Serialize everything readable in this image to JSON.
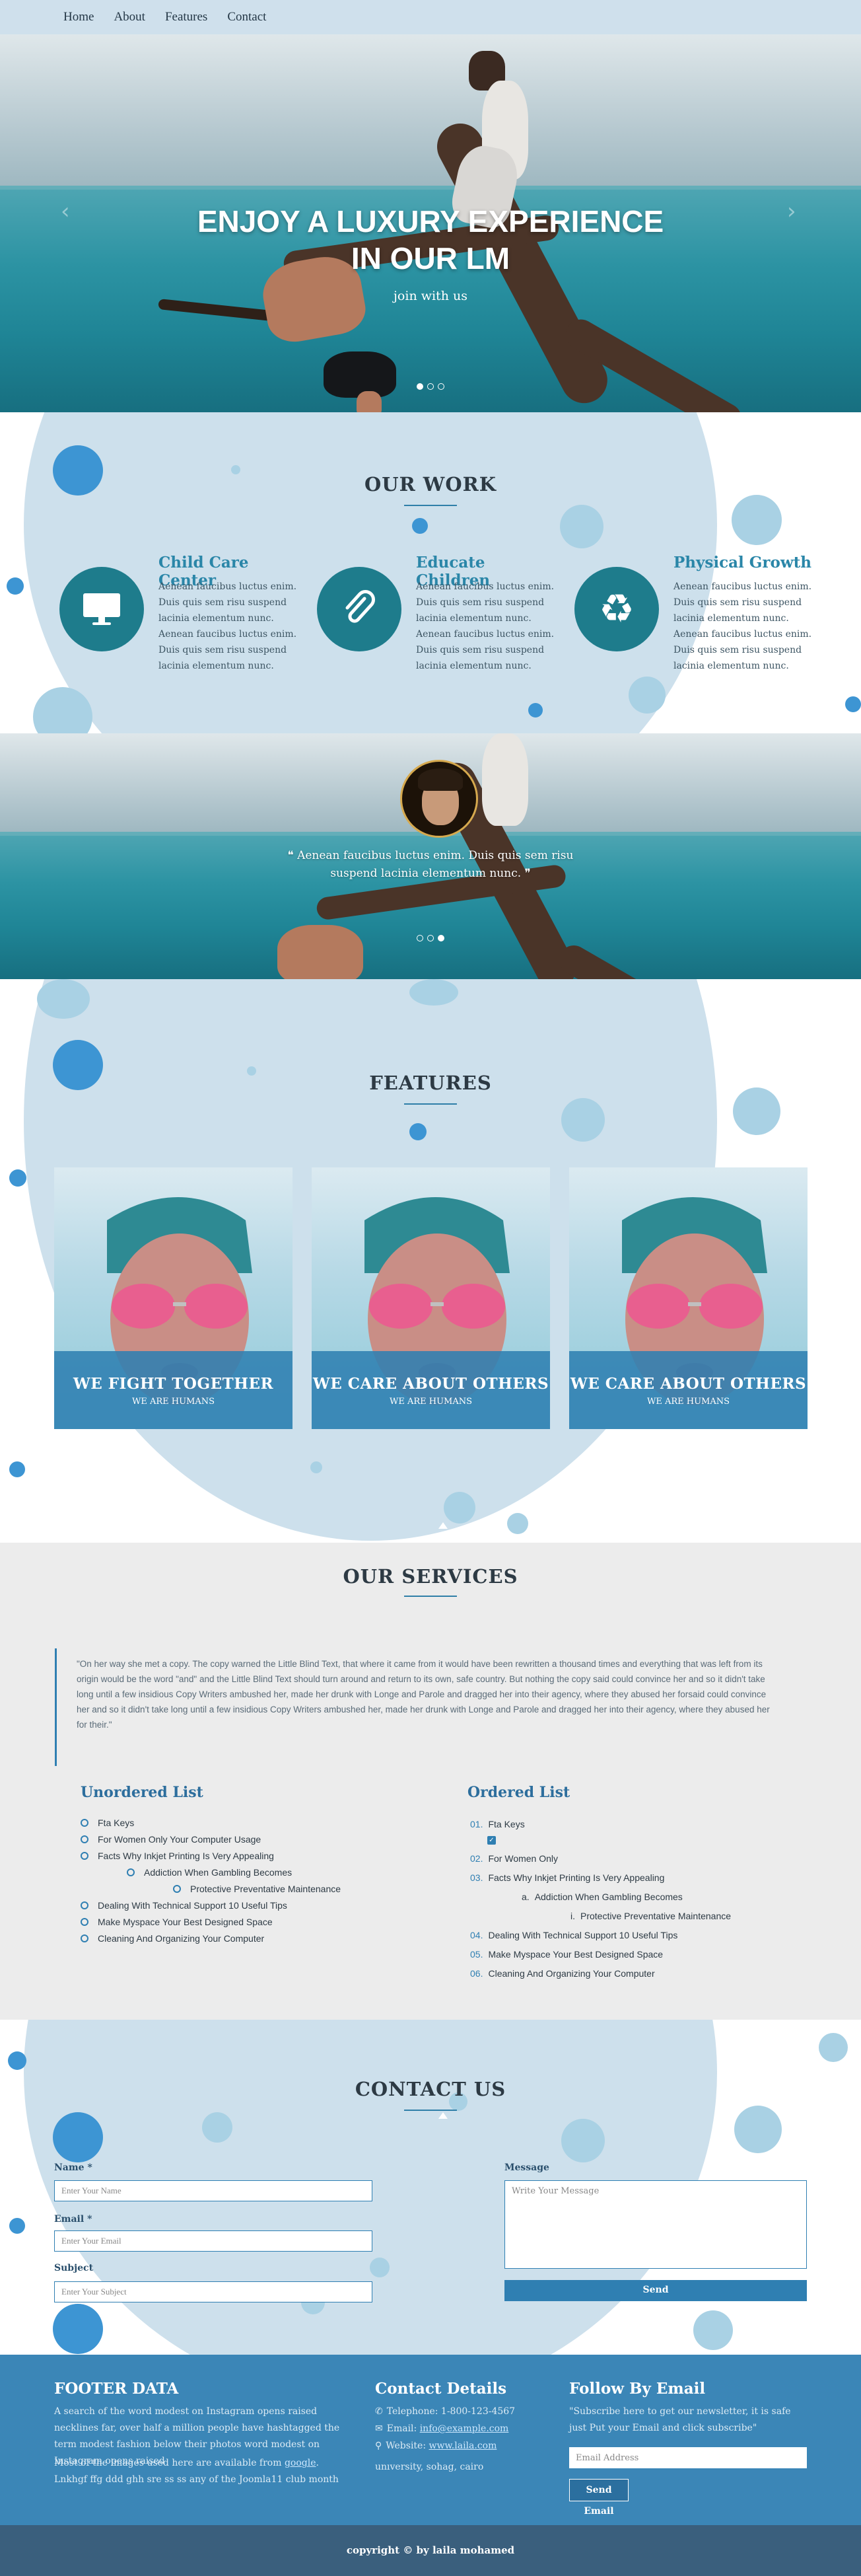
{
  "nav": {
    "items": [
      "Home",
      "About",
      "Features",
      "Contact"
    ]
  },
  "hero": {
    "title_line1": "ENJOY A LUXURY EXPERIENCE",
    "title_line2": "IN OUR LM",
    "subtitle": "join with us",
    "prev_arrow": "‹",
    "next_arrow": "›",
    "slide_count": 3,
    "active_slide": 1
  },
  "work": {
    "title": "OUR WORK",
    "items": [
      {
        "heading": "Child Care Center",
        "text": "Aenean faucibus luctus enim. Duis quis sem risu suspend lacinia elementum nunc. Aenean faucibus luctus enim. Duis quis sem risu suspend lacinia elementum nunc.",
        "icon": "monitor-icon"
      },
      {
        "heading": "Educate Children",
        "text": "Aenean faucibus luctus enim. Duis quis sem risu suspend lacinia elementum nunc. Aenean faucibus luctus enim. Duis quis sem risu suspend lacinia elementum nunc.",
        "icon": "paperclip-icon"
      },
      {
        "heading": "Physical Growth",
        "text": "Aenean faucibus luctus enim. Duis quis sem risu suspend lacinia elementum nunc. Aenean faucibus luctus enim. Duis quis sem risu suspend lacinia elementum nunc.",
        "icon": "recycle-icon"
      }
    ]
  },
  "testimonial": {
    "quote": "❝ Aenean faucibus luctus enim. Duis quis sem risu suspend lacinia elementum nunc. ❞",
    "slide_count": 3,
    "active_slide": 3
  },
  "features": {
    "title": "FEATURES",
    "cards": [
      {
        "title": "WE FIGHT TOGETHER",
        "subtitle": "WE ARE HUMANS"
      },
      {
        "title": "WE CARE ABOUT OTHERS",
        "subtitle": "WE ARE HUMANS"
      },
      {
        "title": "WE CARE ABOUT OTHERS",
        "subtitle": "WE ARE HUMANS"
      }
    ]
  },
  "services": {
    "title": "OUR SERVICES",
    "quote": "\"On her way she met a copy. The copy warned the Little Blind Text, that where it came from it would have been rewritten a thousand times and everything that was left from its origin would be the word \"and\" and the Little Blind Text should turn around and return to its own, safe country. But nothing the copy said could convince her and so it didn't take long until a few insidious Copy Writers ambushed her, made her drunk with Longe and Parole and dragged her into their agency, where they abused her forsaid could convince her and so it didn't take long until a few insidious Copy Writers ambushed her, made her drunk with Longe and Parole and dragged her into their agency, where they abused her for their.\"",
    "unordered_title": "Unordered List",
    "unordered": [
      "Fta Keys",
      "For Women Only Your Computer Usage",
      "Facts Why Inkjet Printing Is Very Appealing",
      "Addiction When Gambling Becomes",
      "Protective Preventative Maintenance",
      "Dealing With Technical Support 10 Useful Tips",
      "Make Myspace Your Best Designed Space",
      "Cleaning And Organizing Your Computer"
    ],
    "ordered_title": "Ordered List",
    "ordered": [
      "Fta Keys",
      "For Women Only",
      "Facts Why Inkjet Printing Is Very Appealing",
      "Addiction When Gambling Becomes",
      "Protective Preventative Maintenance",
      "Dealing With Technical Support 10 Useful Tips",
      "Make Myspace Your Best Designed Space",
      "Cleaning And Organizing Your Computer"
    ],
    "ordered_numbers": [
      "01.",
      "02.",
      "03.",
      "a.",
      "i.",
      "04.",
      "05.",
      "06."
    ]
  },
  "contact": {
    "title": "CONTACT US",
    "name_label": "Name *",
    "name_placeholder": "Enter Your Name",
    "email_label": "Email *",
    "email_placeholder": "Enter Your Email",
    "subject_label": "Subject",
    "subject_placeholder": "Enter Your Subject",
    "message_label": "Message",
    "message_placeholder": "Write Your Message",
    "send_label": "Send"
  },
  "footer": {
    "about_title": "FOOTER DATA",
    "about_text": "A search of the word modest on Instagram opens raised necklines far, over half a million people have hashtagged the term modest fashion below their photos word modest on Instagram opens raised",
    "about_text2_pre": "Most of the images used here are available from",
    "about_link": "google",
    "about_text2_post": ". Lnkhgf ffg ddd ghh sre ss ss any of the Joomla11 club month",
    "contact_title": "Contact Details",
    "telephone": "Telephone: 1-800-123-4567",
    "email_label": "Email:",
    "email_value": "info@example.com",
    "website_label": "Website:",
    "website_value": "www.laila.com",
    "address": "unıversity, sohag, cairo",
    "follow_title": "Follow By Email",
    "follow_text": "\"Subscribe here to get our newsletter, it is safe just Put your Email and click subscribe\"",
    "email_placeholder": "Email Address",
    "send_label": "Send Email",
    "copyright": "copyright © by laila mohamed"
  },
  "colors": {
    "accent": "#2f7fb2",
    "nav_bg": "#cfe0ec",
    "footer_bg": "#3b86b7",
    "copyright_bg": "#3a5f7d",
    "work_icon": "#1e7c8c"
  }
}
